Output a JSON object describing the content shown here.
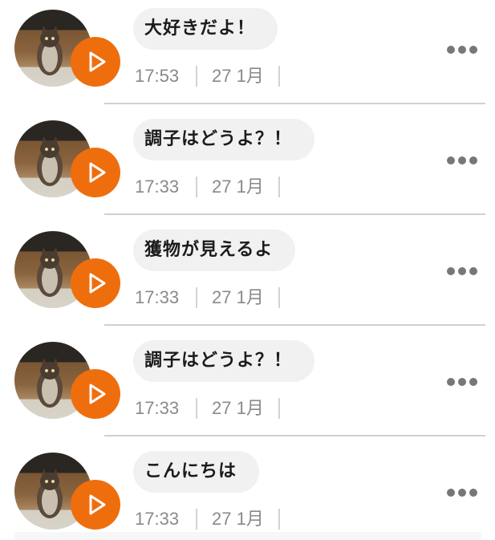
{
  "messages": [
    {
      "text": "大好きだよ！",
      "time": "17:53",
      "date": "27 1月"
    },
    {
      "text": "調子はどうよ？！",
      "time": "17:33",
      "date": "27 1月"
    },
    {
      "text": "獲物が見えるよ",
      "time": "17:33",
      "date": "27 1月"
    },
    {
      "text": "調子はどうよ？！",
      "time": "17:33",
      "date": "27 1月"
    },
    {
      "text": "こんにちは",
      "time": "17:33",
      "date": "27 1月"
    }
  ],
  "icons": {
    "avatar": "cat-photo",
    "play": "play-icon",
    "more": "more-dots-icon"
  },
  "colors": {
    "accent": "#ee6e0e",
    "bubble_bg": "#f1f1f1",
    "meta_text": "#8a8a8a",
    "divider": "#d0d0d0",
    "dots": "#777777"
  }
}
